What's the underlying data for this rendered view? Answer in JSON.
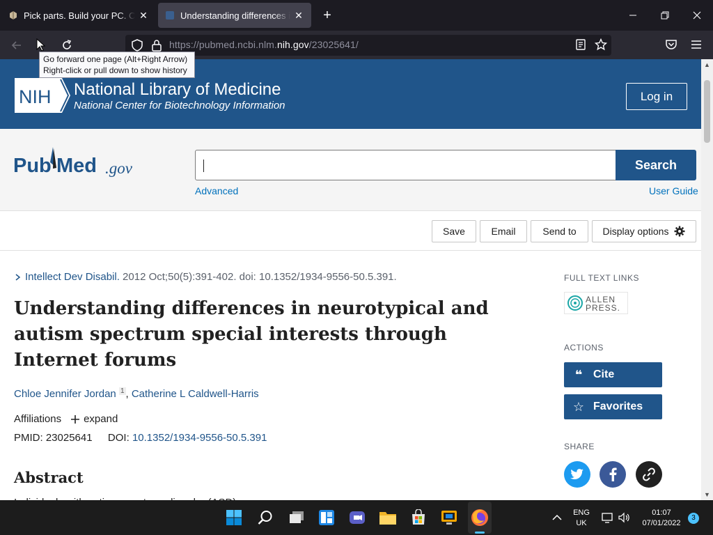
{
  "browser": {
    "tabs": [
      {
        "title": "Pick parts. Build your PC. Compare",
        "active": false
      },
      {
        "title": "Understanding differences in neuro",
        "active": true
      }
    ],
    "url_prefix": "https://pubmed.ncbi.nlm.",
    "url_host": "nih.gov",
    "url_path": "/23025641/",
    "tooltip_line1": "Go forward one page (Alt+Right Arrow)",
    "tooltip_line2": "Right-click or pull down to show history"
  },
  "nih_banner": {
    "logo_text": "NIH",
    "title": "National Library of Medicine",
    "subtitle": "National Center for Biotechnology Information",
    "login_label": "Log in"
  },
  "search": {
    "logo_pub": "Pub",
    "logo_med": "Med",
    "logo_gov": ".gov",
    "value": "",
    "button_label": "Search",
    "advanced_label": "Advanced",
    "user_guide_label": "User Guide"
  },
  "actions_bar": {
    "save": "Save",
    "email": "Email",
    "send_to": "Send to",
    "display_options": "Display options"
  },
  "article": {
    "journal": "Intellect Dev Disabil.",
    "citation": " 2012 Oct;50(5):391-402. doi: 10.1352/1934-9556-50.5.391.",
    "title": "Understanding differences in neurotypical and autism spectrum special interests through Internet forums",
    "author1": "Chloe Jennifer Jordan",
    "author1_sup": "1",
    "author2": "Catherine L Caldwell-Harris",
    "affiliations_label": "Affiliations",
    "expand_label": "expand",
    "pmid_label": "PMID: 23025641",
    "doi_label": "DOI: ",
    "doi_value": "10.1352/1934-9556-50.5.391",
    "abstract_heading": "Abstract",
    "abstract_partial": "Individuals with autism spectrum disorder (ASD) ..."
  },
  "sidebar": {
    "full_text_heading": "FULL TEXT LINKS",
    "allen_line1": "ALLEN",
    "allen_line2": "PRESS.",
    "actions_heading": "ACTIONS",
    "cite_label": "Cite",
    "favorites_label": "Favorites",
    "share_heading": "SHARE"
  },
  "taskbar": {
    "lang1": "ENG",
    "lang2": "UK",
    "time": "01:07",
    "date": "07/01/2022",
    "notifications": "3"
  },
  "colors": {
    "nih_blue": "#20558a",
    "link_blue": "#0071bc",
    "twitter": "#1d9bf0",
    "facebook": "#3b5998",
    "copy_link": "#212121"
  }
}
